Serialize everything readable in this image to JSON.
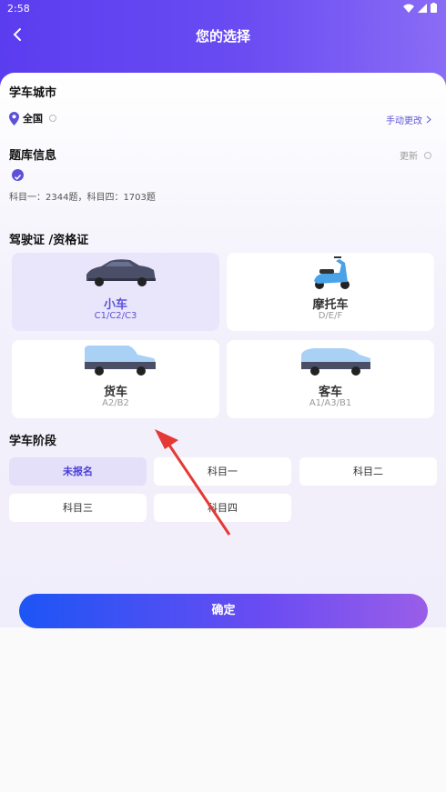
{
  "status_bar": {
    "time": "2:58"
  },
  "nav": {
    "title": "您的选择"
  },
  "city": {
    "title": "学车城市",
    "value": "全国",
    "change_link": "手动更改"
  },
  "question_bank": {
    "title": "题库信息",
    "update_link": "更新",
    "info": "科目一：2344题，科目四：1703题"
  },
  "license": {
    "title": "驾驶证 /资格证",
    "cards": [
      {
        "name": "小车",
        "codes": "C1/C2/C3",
        "selected": true
      },
      {
        "name": "摩托车",
        "codes": "D/E/F",
        "selected": false
      },
      {
        "name": "货车",
        "codes": "A2/B2",
        "selected": false
      },
      {
        "name": "客车",
        "codes": "A1/A3/B1",
        "selected": false
      }
    ]
  },
  "stage": {
    "title": "学车阶段",
    "options": [
      {
        "label": "未报名",
        "selected": true
      },
      {
        "label": "科目一",
        "selected": false
      },
      {
        "label": "科目二",
        "selected": false
      },
      {
        "label": "科目三",
        "selected": false
      },
      {
        "label": "科目四",
        "selected": false
      }
    ]
  },
  "confirm_label": "确定",
  "colors": {
    "accent": "#5b52d8",
    "header": "#5b3df0",
    "annotation_arrow": "#e53935"
  }
}
